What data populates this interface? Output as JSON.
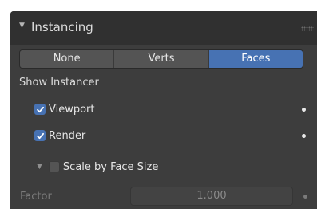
{
  "panel": {
    "title": "Instancing",
    "modes": [
      {
        "label": "None",
        "active": false
      },
      {
        "label": "Verts",
        "active": false
      },
      {
        "label": "Faces",
        "active": true
      }
    ],
    "show_instancer_label": "Show Instancer",
    "viewport": {
      "label": "Viewport",
      "checked": true
    },
    "render": {
      "label": "Render",
      "checked": true
    },
    "scale_by_face_size": {
      "label": "Scale by Face Size",
      "checked": false
    },
    "factor": {
      "label": "Factor",
      "value": "1.000"
    },
    "accent_color": "#4772b3"
  }
}
